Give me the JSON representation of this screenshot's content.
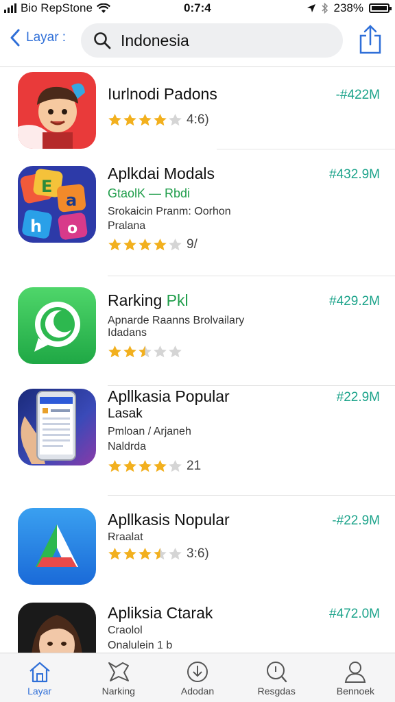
{
  "status_bar": {
    "carrier": "Bio RepStone",
    "time": "0:7:4",
    "battery": "238%"
  },
  "nav": {
    "back_label": "Layar :",
    "search_value": "Indonesia"
  },
  "apps": [
    {
      "name": "Iurlnodi Padons",
      "price": "-#422M",
      "lines": [],
      "rating": 4,
      "rating_count": "4:6)"
    },
    {
      "name": "Aplkdai Modals",
      "price": "#432.9M",
      "subtitle": "GtaolK — Rbdi",
      "lines": [
        "Srokaicin Pranm: Oorhon",
        "Pralana"
      ],
      "rating": 4,
      "rating_count": "9/"
    },
    {
      "name": "Rarking",
      "name_accent": "Pkl",
      "price": "#429.2M",
      "lines": [
        "Apnarde Raanns Brolvailary",
        "Idadans"
      ],
      "rating": 2.5,
      "rating_count": ""
    },
    {
      "name": "Apllkasia Popular",
      "price": "#22.9M",
      "subtitle_dark": "Lasak",
      "lines": [
        "Pmloan / Arjaneh",
        "Naldrda"
      ],
      "rating": 4,
      "rating_count": "21"
    },
    {
      "name": "Apllkasis Nopular",
      "price": "-#22.9M",
      "lines": [
        "Rraalat"
      ],
      "rating": 3.5,
      "rating_count": "3:6)"
    },
    {
      "name": "Apliksia Ctarak",
      "price": "#472.0M",
      "lines": [
        "Craolol",
        "Onalulein 1 b"
      ],
      "rating": 0,
      "rating_count": ""
    }
  ],
  "tabs": [
    {
      "label": "Layar",
      "icon": "home-icon",
      "active": true
    },
    {
      "label": "Narking",
      "icon": "flag-icon",
      "active": false
    },
    {
      "label": "Adodan",
      "icon": "download-icon",
      "active": false
    },
    {
      "label": "Resgdas",
      "icon": "search-icon",
      "active": false
    },
    {
      "label": "Bennoek",
      "icon": "person-icon",
      "active": false
    }
  ],
  "colors": {
    "accent": "#2f6fd8",
    "price": "#1ba38a",
    "star": "#f2b01e",
    "star_empty": "#d5d5d5",
    "subtitle_green": "#1f9d4a"
  }
}
